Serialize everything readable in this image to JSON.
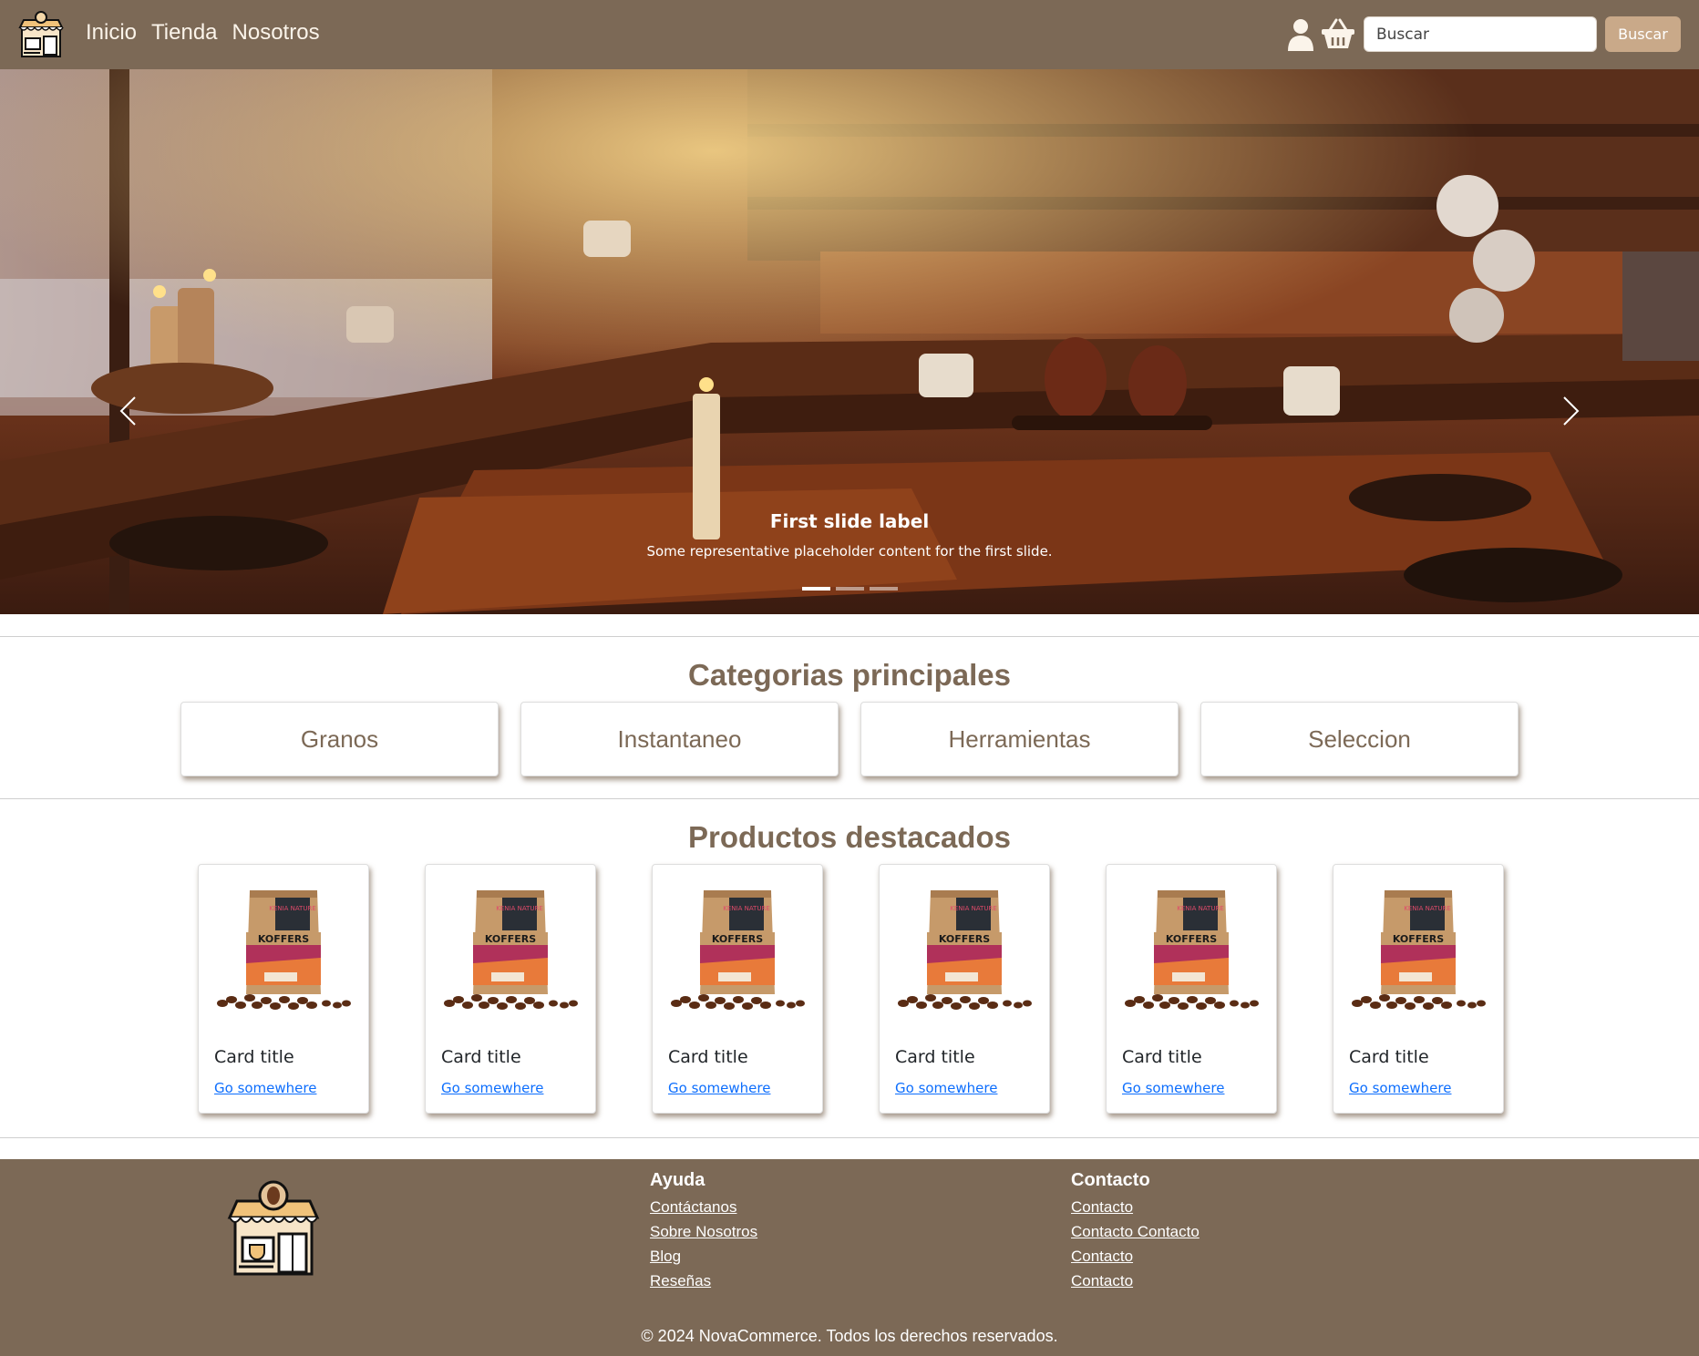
{
  "nav": {
    "links": [
      "Inicio",
      "Tienda",
      "Nosotros"
    ],
    "search_placeholder": "Buscar",
    "search_button": "Buscar"
  },
  "carousel": {
    "caption_title": "First slide label",
    "caption_text": "Some representative placeholder content for the first slide.",
    "indicators": 3,
    "active_index": 0
  },
  "categories": {
    "title": "Categorias principales",
    "items": [
      "Granos",
      "Instantaneo",
      "Herramientas",
      "Seleccion"
    ]
  },
  "products": {
    "title": "Productos destacados",
    "items": [
      {
        "title": "Card title",
        "link": "Go somewhere"
      },
      {
        "title": "Card title",
        "link": "Go somewhere"
      },
      {
        "title": "Card title",
        "link": "Go somewhere"
      },
      {
        "title": "Card title",
        "link": "Go somewhere"
      },
      {
        "title": "Card title",
        "link": "Go somewhere"
      },
      {
        "title": "Card title",
        "link": "Go somewhere"
      }
    ],
    "bag_brand": "KOFFERS",
    "bag_label": "KENIA NATURE"
  },
  "footer": {
    "help": {
      "title": "Ayuda",
      "links": [
        "Contáctanos",
        "Sobre Nosotros",
        "Blog",
        "Reseñas"
      ]
    },
    "contact": {
      "title": "Contacto",
      "links": [
        "Contacto",
        "Contacto Contacto",
        "Contacto",
        "Contacto"
      ]
    },
    "copyright": "© 2024 NovaCommerce. Todos los derechos reservados."
  },
  "colors": {
    "brand": "#7c6956",
    "button": "#c9a989",
    "link": "#0d6efd"
  }
}
